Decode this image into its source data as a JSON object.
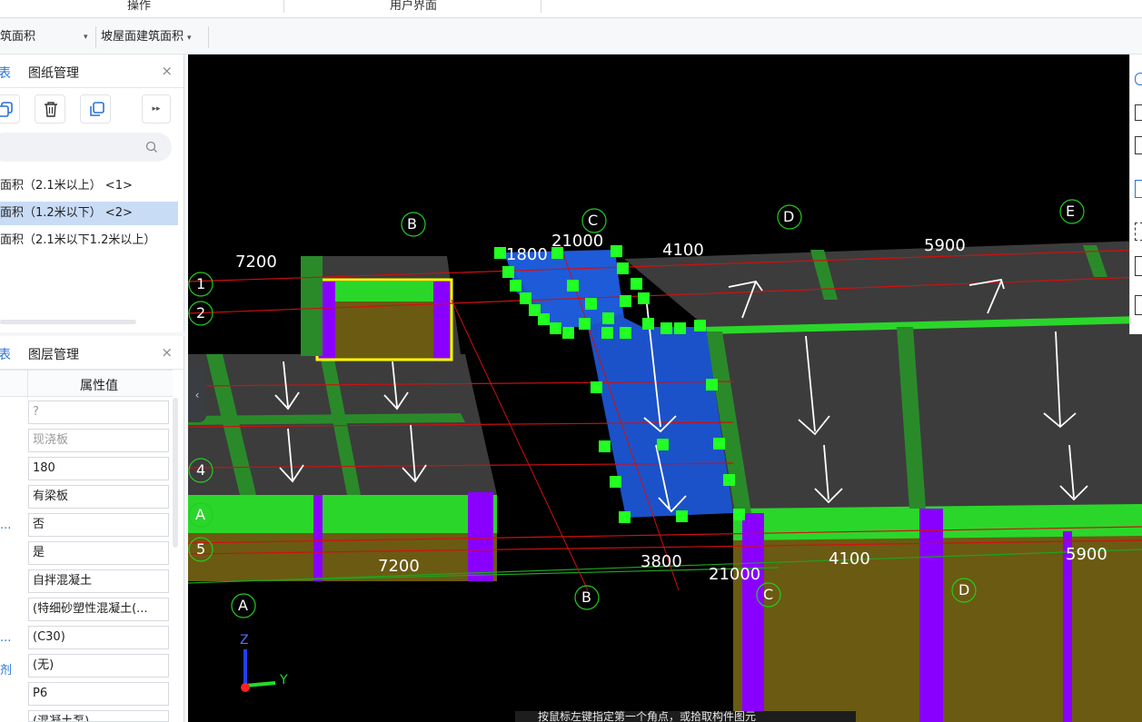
{
  "ribbon": {
    "group_operations": "操作",
    "group_ui": "用户界面"
  },
  "combos": {
    "floor_area": "筑面积",
    "slope_roof_area": "坡屋面建筑面积"
  },
  "drawing_panel": {
    "tab_left": "表",
    "tab_drawing": "图纸管理",
    "close": "×",
    "more_glyph": "▸▸",
    "items": [
      "面积（2.1米以上） <1>",
      "面积（1.2米以下） <2>",
      "面积（2.1米以下1.2米以上）"
    ],
    "selected_index": 1
  },
  "layer_panel": {
    "tab_left": "表",
    "tab_layer": "图层管理",
    "close": "×",
    "column_value": "属性值",
    "values": [
      "?",
      "现浇板",
      "180",
      "有梁板",
      "否",
      "是",
      "自拌混凝土",
      "(特细砂塑性混凝土(...",
      "(C30)",
      "(无)",
      "P6",
      "(混凝土泵)"
    ],
    "gray_rows": [
      0,
      1
    ],
    "side_labels": {
      "row4": "...",
      "row8": "...",
      "row9": "剂"
    }
  },
  "viewport": {
    "background": "#000000",
    "axis_labels": {
      "z": "Z",
      "y": "Y"
    },
    "grid_bubbles": [
      "B",
      "C",
      "D",
      "E",
      "1",
      "2",
      "4",
      "A",
      "5",
      "A",
      "B",
      "C",
      "D"
    ],
    "dimensions": {
      "top_7200": "7200",
      "top_1800": "1800",
      "top_21000": "21000",
      "top_4100": "4100",
      "top_5900": "5900",
      "bottom_7200": "7200",
      "bottom_3800": "3800",
      "bottom_21000": "21000",
      "bottom_4100": "4100",
      "bottom_5900": "5900"
    },
    "collapse_glyph": "‹",
    "colors": {
      "slab": "#3c3c3c",
      "beam_green": "#2bd62b",
      "column_purple": "#8a00ff",
      "wall_olive": "#6b5a12",
      "selected_blue": "#1b52c9",
      "grip": "#22ff22",
      "selection_yellow": "#ffff00",
      "gridline_red": "#d01010"
    }
  },
  "status": {
    "text": "按鼠标左键指定第一个角点，或拾取构件图元"
  }
}
